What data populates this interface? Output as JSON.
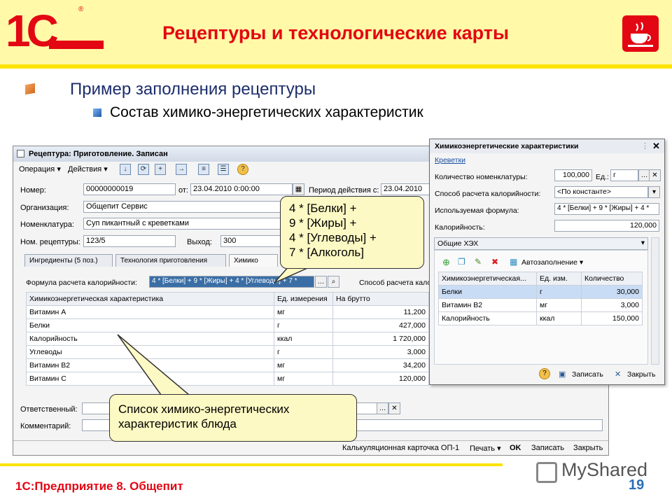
{
  "slide": {
    "title": "Рецептуры и технологические карты",
    "bullet1": "Пример заполнения рецептуры",
    "bullet2": "Состав химико-энергетических характеристик",
    "footer": "1С:Предприятие 8. Общепит",
    "page": "19",
    "watermark": "MyShared",
    "logo": "1С",
    "colors": {
      "brand": "#e30613",
      "header_bg": "#fff9a8",
      "accent": "#fde200"
    }
  },
  "main": {
    "title": "Рецептура: Приготовление. Записан",
    "toolbar": {
      "operation": "Операция ▾",
      "actions": "Действия ▾"
    },
    "labels": {
      "number": "Номер:",
      "from": "от:",
      "period": "Период действия с:",
      "org": "Организация:",
      "nomenclature": "Номенклатура:",
      "recipe_no": "Ном. рецептуры:",
      "output": "Выход:",
      "formula": "Формула расчета калорийности:",
      "calc_method": "Способ расчета кало",
      "responsible": "Ответственный:",
      "comment": "Комментарий:"
    },
    "values": {
      "number": "00000000019",
      "date": "23.04.2010 0:00:00",
      "period_from": "23.04.2010",
      "org": "Общепит Сервис",
      "nomenclature": "Суп пикантный с креветками",
      "recipe_no": "123/5",
      "output": "300",
      "formula": "4 * [Белки] + 9 * [Жиры] + 4 * [Углеводы] + 7 *"
    },
    "tabs": [
      "Ингредиенты (5 поз.)",
      "Технология приготовления",
      "Химико"
    ],
    "table": {
      "headers": [
        "Химикоэнергетическая характеристика",
        "Ед. измерения",
        "На брутто"
      ],
      "rows": [
        [
          "Витамин А",
          "мг",
          "11,200"
        ],
        [
          "Белки",
          "г",
          "427,000"
        ],
        [
          "Калорийность",
          "ккал",
          "1 720,000"
        ],
        [
          "Углеводы",
          "г",
          "3,000"
        ],
        [
          "Витамин В2",
          "мг",
          "34,200"
        ],
        [
          "Витамин С",
          "мг",
          "120,000"
        ]
      ]
    },
    "bottom": {
      "card": "Калькуляционная карточка ОП-1",
      "print": "Печать ▾",
      "ok": "OK",
      "save": "Записать",
      "close": "Закрыть"
    }
  },
  "popup": {
    "title": "Химикоэнергетические характеристики",
    "link": "Креветки",
    "labels": {
      "qty": "Количество номенклатуры:",
      "unit": "Ед.:",
      "method": "Способ расчета калорийности:",
      "formula": "Используемая формула:",
      "calories": "Калорийность:"
    },
    "values": {
      "qty": "100,000",
      "unit": "г",
      "method": "<По константе>",
      "formula": "4 * [Белки] + 9 * [Жиры] + 4 *",
      "calories": "120,000"
    },
    "section": "Общие ХЭХ",
    "autofill": "Автозаполнение ▾",
    "table": {
      "headers": [
        "Химикоэнергетическая...",
        "Ед. изм.",
        "Количество"
      ],
      "rows": [
        [
          "Белки",
          "г",
          "30,000"
        ],
        [
          "Витамин В2",
          "мг",
          "3,000"
        ],
        [
          "Калорийность",
          "ккал",
          "150,000"
        ]
      ]
    },
    "bottom": {
      "help": "?",
      "save": "Записать",
      "close": "Закрыть"
    }
  },
  "callouts": {
    "formula": [
      "4 * [Белки] +",
      "9 * [Жиры] +",
      "4 * [Углеводы] +",
      "7 * [Алкоголь]"
    ],
    "list": [
      "Список химико-энергетических",
      "характеристик блюда"
    ]
  }
}
